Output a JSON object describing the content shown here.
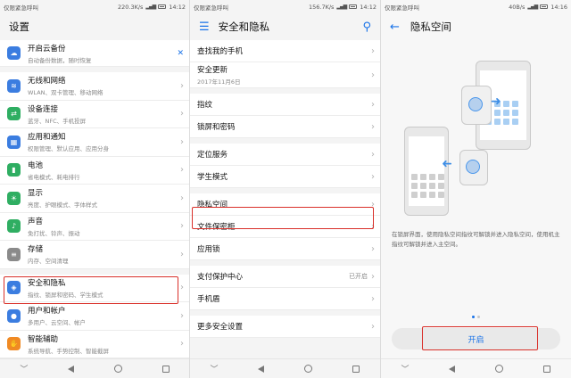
{
  "panel1": {
    "status": {
      "carrier": "仅限紧急呼叫",
      "speed": "220.3K/s",
      "time": "14:12"
    },
    "title": "设置",
    "banner": {
      "title": "开启云备份",
      "subtitle": "自动备份数据，随时恢复",
      "close": "✕"
    },
    "items": [
      {
        "icon": "wifi-icon",
        "color": "#3b7de0",
        "glyph": "≋",
        "title": "无线和网络",
        "subtitle": "WLAN、双卡管理、移动网络"
      },
      {
        "icon": "device-connect-icon",
        "color": "#2fae62",
        "glyph": "⇄",
        "title": "设备连接",
        "subtitle": "蓝牙、NFC、手机投屏"
      },
      {
        "icon": "apps-icon",
        "color": "#3b7de0",
        "glyph": "▦",
        "title": "应用和通知",
        "subtitle": "权限管理、默认应用、应用分身"
      },
      {
        "icon": "battery-icon",
        "color": "#2fae62",
        "glyph": "▮",
        "title": "电池",
        "subtitle": "省电模式、耗电排行"
      },
      {
        "icon": "display-icon",
        "color": "#2fae62",
        "glyph": "☀",
        "title": "显示",
        "subtitle": "亮度、护眼模式、字体样式"
      },
      {
        "icon": "sound-icon",
        "color": "#2fae62",
        "glyph": "♪",
        "title": "声音",
        "subtitle": "免打扰、铃声、振动"
      },
      {
        "icon": "storage-icon",
        "color": "#8a8a8a",
        "glyph": "≡",
        "title": "存储",
        "subtitle": "内存、空间清理"
      },
      {
        "icon": "security-icon",
        "color": "#3b7de0",
        "glyph": "◈",
        "title": "安全和隐私",
        "subtitle": "指纹、锁屏和密码、学生模式"
      },
      {
        "icon": "user-icon",
        "color": "#3b7de0",
        "glyph": "●",
        "title": "用户和帐户",
        "subtitle": "多用户、云空间、帐户"
      },
      {
        "icon": "accessibility-icon",
        "color": "#f08a24",
        "glyph": "✋",
        "title": "智能辅助",
        "subtitle": "系统导航、手势控制、智能截屏"
      }
    ]
  },
  "panel2": {
    "status": {
      "carrier": "仅限紧急呼叫",
      "speed": "156.7K/s",
      "time": "14:12"
    },
    "title": "安全和隐私",
    "items": [
      {
        "title": "查找我的手机",
        "subtitle": "",
        "value": ""
      },
      {
        "title": "安全更新",
        "subtitle": "2017年11月6日",
        "value": ""
      },
      {
        "title": "指纹",
        "subtitle": "",
        "value": ""
      },
      {
        "title": "锁屏和密码",
        "subtitle": "",
        "value": ""
      },
      {
        "title": "定位服务",
        "subtitle": "",
        "value": ""
      },
      {
        "title": "学生模式",
        "subtitle": "",
        "value": ""
      },
      {
        "title": "隐私空间",
        "subtitle": "",
        "value": ""
      },
      {
        "title": "文件保密柜",
        "subtitle": "",
        "value": ""
      },
      {
        "title": "应用锁",
        "subtitle": "",
        "value": ""
      },
      {
        "title": "支付保护中心",
        "subtitle": "",
        "value": "已开启"
      },
      {
        "title": "手机盾",
        "subtitle": "",
        "value": ""
      },
      {
        "title": "更多安全设置",
        "subtitle": "",
        "value": ""
      }
    ]
  },
  "panel3": {
    "status": {
      "carrier": "仅限紧急呼叫",
      "speed": "40B/s",
      "time": "14:16"
    },
    "title": "隐私空间",
    "description": "在锁屏界面，使用隐私空间指纹可解锁并进入隐私空间，使用机主指纹可解锁并进入主空间。",
    "button": "开启"
  }
}
